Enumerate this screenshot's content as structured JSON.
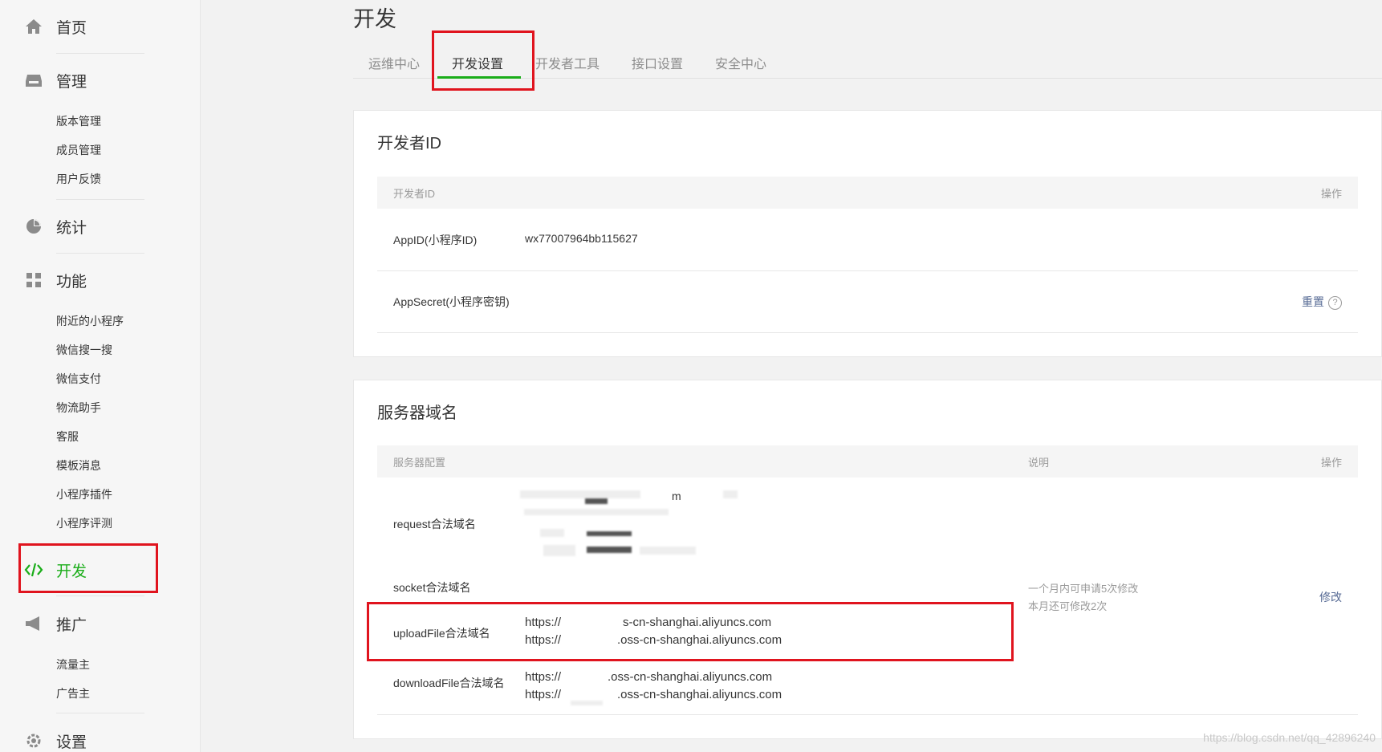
{
  "sidebar": {
    "home": "首页",
    "manage": "管理",
    "manage_items": [
      "版本管理",
      "成员管理",
      "用户反馈"
    ],
    "stats": "统计",
    "features": "功能",
    "feature_items": [
      "附近的小程序",
      "微信搜一搜",
      "微信支付",
      "物流助手",
      "客服",
      "模板消息",
      "小程序插件",
      "小程序评测"
    ],
    "develop": "开发",
    "promote": "推广",
    "promote_items": [
      "流量主",
      "广告主"
    ],
    "settings": "设置",
    "accent": "#1aad19"
  },
  "page": {
    "title": "开发",
    "tabs": [
      "运维中心",
      "开发设置",
      "开发者工具",
      "接口设置",
      "安全中心"
    ],
    "active_tab": "开发设置"
  },
  "developer_id": {
    "title": "开发者ID",
    "col_name": "开发者ID",
    "col_action": "操作",
    "appid_label": "AppID(小程序ID)",
    "appid_value": "wx77007964bb115627",
    "secret_label": "AppSecret(小程序密钥)",
    "reset": "重置",
    "help": "?"
  },
  "server_domain": {
    "title": "服务器域名",
    "col_config": "服务器配置",
    "col_desc": "说明",
    "col_action": "操作",
    "request_label": "request合法域名",
    "request_fragments": [
      "m",
      "com",
      "com",
      ")"
    ],
    "socket_label": "socket合法域名",
    "upload_label": "uploadFile合法域名",
    "upload_urls": [
      "https://",
      "s-cn-shanghai.aliyuncs.com",
      "https://",
      ".oss-cn-shanghai.aliyuncs.com"
    ],
    "download_label": "downloadFile合法域名",
    "download_urls": [
      "https://",
      ".oss-cn-shanghai.aliyuncs.com",
      "https://",
      ".oss-cn-shanghai.aliyuncs.com"
    ],
    "desc_line1": "一个月内可申请5次修改",
    "desc_line2": "本月还可修改2次",
    "modify": "修改"
  },
  "watermark": "https://blog.csdn.net/qq_42896240"
}
